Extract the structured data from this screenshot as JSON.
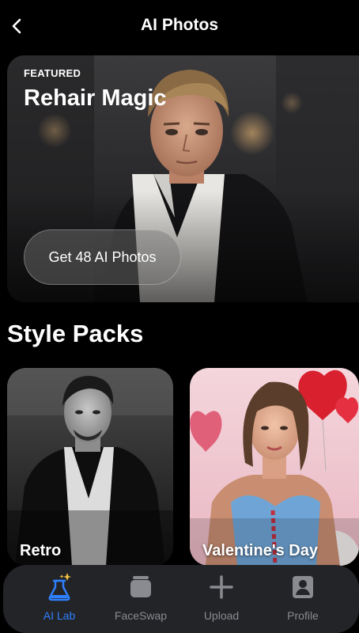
{
  "header": {
    "title": "AI Photos"
  },
  "hero": {
    "badge": "FEATURED",
    "title": "Rehair Magic",
    "cta_label": "Get 48 AI Photos"
  },
  "style_packs": {
    "title": "Style Packs",
    "cards": [
      {
        "label": "Retro"
      },
      {
        "label": "Valentine's Day"
      }
    ]
  },
  "nav": {
    "items": [
      {
        "label": "AI Lab",
        "icon": "flask-sparkle-icon",
        "active": true
      },
      {
        "label": "FaceSwap",
        "icon": "stack-icon",
        "active": false
      },
      {
        "label": "Upload",
        "icon": "plus-icon",
        "active": false
      },
      {
        "label": "Profile",
        "icon": "person-icon",
        "active": false
      }
    ],
    "active_color": "#2f80ff",
    "inactive_color": "#8a8b90"
  }
}
